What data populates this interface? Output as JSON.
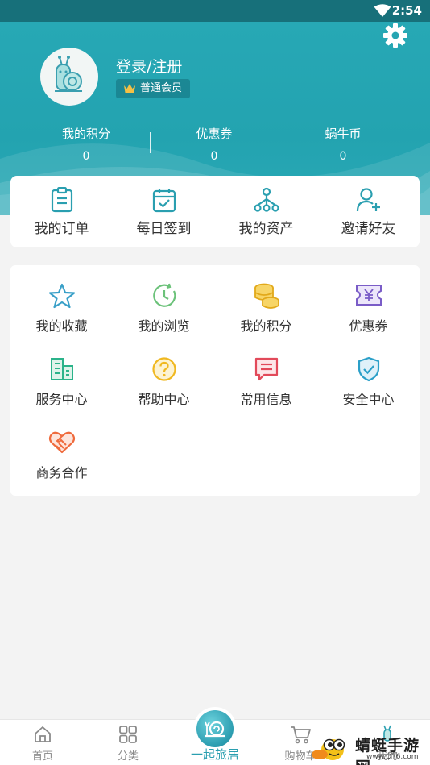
{
  "status_bar": {
    "time": "2:54"
  },
  "profile": {
    "login_text": "登录/注册",
    "member_level": "普通会员"
  },
  "stats": [
    {
      "label": "我的积分",
      "value": "0"
    },
    {
      "label": "优惠券",
      "value": "0"
    },
    {
      "label": "蜗牛币",
      "value": "0"
    }
  ],
  "quick_actions": [
    {
      "label": "我的订单",
      "icon": "order-list-icon"
    },
    {
      "label": "每日签到",
      "icon": "calendar-check-icon"
    },
    {
      "label": "我的资产",
      "icon": "asset-tree-icon"
    },
    {
      "label": "邀请好友",
      "icon": "add-user-icon"
    }
  ],
  "services": [
    {
      "label": "我的收藏",
      "icon": "star-icon",
      "color": "#3aa0c8"
    },
    {
      "label": "我的浏览",
      "icon": "clock-icon",
      "color": "#6cc27a"
    },
    {
      "label": "我的积分",
      "icon": "coins-icon",
      "color": "#e8b62a"
    },
    {
      "label": "优惠券",
      "icon": "coupon-icon",
      "color": "#7a5cc7"
    },
    {
      "label": "服务中心",
      "icon": "building-icon",
      "color": "#2bb38a"
    },
    {
      "label": "帮助中心",
      "icon": "help-icon",
      "color": "#f0b820"
    },
    {
      "label": "常用信息",
      "icon": "message-icon",
      "color": "#e24a5a"
    },
    {
      "label": "安全中心",
      "icon": "shield-check-icon",
      "color": "#2a9fc8"
    },
    {
      "label": "商务合作",
      "icon": "handshake-icon",
      "color": "#ef6a3c"
    }
  ],
  "tabbar": [
    {
      "label": "首页",
      "icon": "home-icon"
    },
    {
      "label": "分类",
      "icon": "grid-icon"
    },
    {
      "label": "一起旅居",
      "icon": "snail-logo-icon"
    },
    {
      "label": "购物车",
      "icon": "cart-icon"
    },
    {
      "label": "我的",
      "icon": "user-icon"
    }
  ],
  "watermark": {
    "text": "蜻蜓手游网",
    "url": "www.QT6.com"
  },
  "colors": {
    "primary": "#23a3b0",
    "tab_active": "#2a9fb0"
  }
}
